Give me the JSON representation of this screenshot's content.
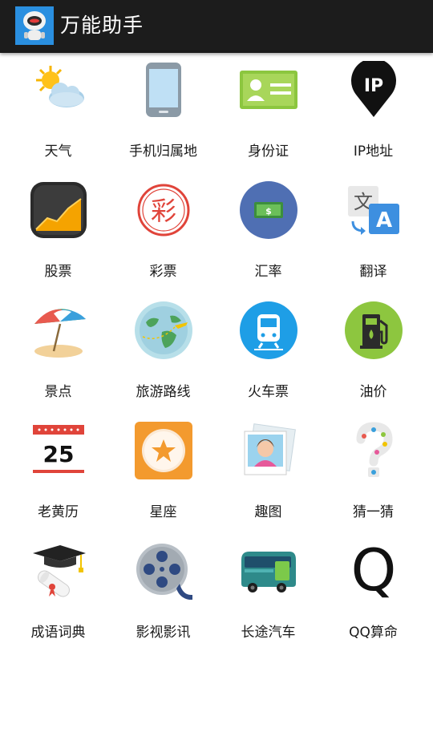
{
  "app": {
    "title": "万能助手"
  },
  "tiles": [
    {
      "label": "天气",
      "icon": "weather-sun-cloud-icon"
    },
    {
      "label": "手机归属地",
      "icon": "mobile-phone-icon"
    },
    {
      "label": "身份证",
      "icon": "id-card-icon"
    },
    {
      "label": "IP地址",
      "icon": "ip-location-pin-icon",
      "icon_text": "IP"
    },
    {
      "label": "股票",
      "icon": "stock-chart-icon"
    },
    {
      "label": "彩票",
      "icon": "lottery-seal-icon",
      "icon_text": "彩"
    },
    {
      "label": "汇率",
      "icon": "currency-exchange-icon",
      "icon_text": "$"
    },
    {
      "label": "翻译",
      "icon": "translate-icon",
      "icon_text_a": "文",
      "icon_text_b": "A"
    },
    {
      "label": "景点",
      "icon": "beach-umbrella-icon"
    },
    {
      "label": "旅游路线",
      "icon": "globe-plane-icon"
    },
    {
      "label": "火车票",
      "icon": "train-icon"
    },
    {
      "label": "油价",
      "icon": "gas-pump-icon"
    },
    {
      "label": "老黄历",
      "icon": "calendar-icon",
      "icon_text": "25"
    },
    {
      "label": "星座",
      "icon": "star-sign-icon"
    },
    {
      "label": "趣图",
      "icon": "photo-icon"
    },
    {
      "label": "猜一猜",
      "icon": "question-mark-icon"
    },
    {
      "label": "成语词典",
      "icon": "graduation-cap-scroll-icon"
    },
    {
      "label": "影视影讯",
      "icon": "film-reel-icon"
    },
    {
      "label": "长途汽车",
      "icon": "bus-icon"
    },
    {
      "label": "QQ算命",
      "icon": "q-letter-icon",
      "icon_text": "Q"
    }
  ]
}
